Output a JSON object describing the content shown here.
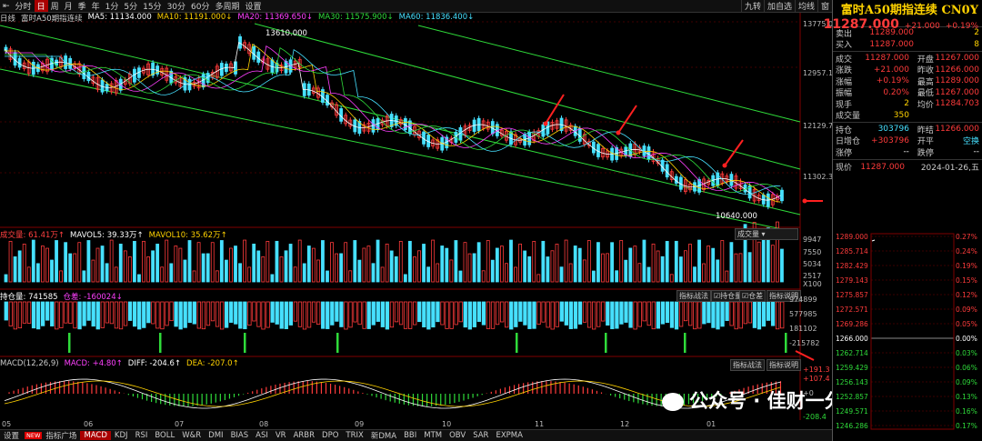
{
  "toolbar": {
    "items": [
      "分时",
      "日",
      "周",
      "月",
      "季",
      "年",
      "1分",
      "5分",
      "15分",
      "30分",
      "60分",
      "多周期",
      "设置"
    ],
    "active": "日",
    "right": [
      "九转",
      "加自选",
      "均线",
      "窗"
    ]
  },
  "ma_legend": {
    "name": "富时A50期指连续",
    "ma5": "MA5: 11134.000",
    "ma10": "MA10: 11191.000↓",
    "ma20": "MA20: 11369.650↓",
    "ma30": "MA30: 11575.900↓",
    "ma60": "MA60: 11836.400↓",
    "prefix": "日线"
  },
  "price_axis": [
    "13775.00",
    "12957.13",
    "12129.75",
    "11302.37"
  ],
  "annotations": {
    "high": "13610.000",
    "low": "10640.000"
  },
  "volume": {
    "label": "成交量: 61.41万↑",
    "mavol5": "MAVOL5: 39.33万↑",
    "mavol10": "MAVOL10: 35.62万↑",
    "selector": "成交量",
    "axis": [
      "9947",
      "7550",
      "5034",
      "2517",
      "X100"
    ]
  },
  "oi": {
    "label": "持仓量: 741585",
    "change": "仓差: -160024↓",
    "buttons": [
      "指标战法",
      "持仓量",
      "仓差",
      "指标说明"
    ],
    "axis": [
      "974899",
      "577985",
      "181102",
      "-215782"
    ]
  },
  "macd": {
    "label": "MACD(12,26,9)",
    "macd": "MACD: +4.80↑",
    "diff": "DIFF: -204.6↑",
    "dea": "DEA: -207.0↑",
    "buttons": [
      "指标战法",
      "指标说明"
    ],
    "axis": [
      "+191.3",
      "+107.4",
      "+0",
      "-208.4"
    ]
  },
  "months": [
    "05",
    "06",
    "07",
    "08",
    "09",
    "10",
    "11",
    "12",
    "01"
  ],
  "bottom_nav": [
    "设置",
    "指标广场",
    "MACD",
    "KDJ",
    "RSI",
    "BOLL",
    "W&R",
    "DMI",
    "BIAS",
    "ASI",
    "VR",
    "ARBR",
    "DPO",
    "TRIX",
    "新DMA",
    "BBI",
    "MTM",
    "OBV",
    "SAR",
    "EXPMA"
  ],
  "bottom_nav_active": "MACD",
  "bottom_nav_new": "NEW",
  "quote": {
    "name": "富时A50期指连续 CN0Y",
    "price": "11287.000",
    "change": "+21.000",
    "pct": "+0.19%",
    "ask_label": "卖出",
    "ask": "11289.000",
    "ask_vol": "2",
    "bid_label": "买入",
    "bid": "11287.000",
    "bid_vol": "8",
    "rows": [
      {
        "k": "成交",
        "v": "11287.000",
        "k2": "开盘",
        "v2": "11267.000"
      },
      {
        "k": "涨跌",
        "v": "+21.000",
        "k2": "昨收",
        "v2": "11266.000"
      },
      {
        "k": "涨幅",
        "v": "+0.19%",
        "k2": "最高",
        "v2": "11289.000"
      },
      {
        "k": "振幅",
        "v": "0.20%",
        "k2": "最低",
        "v2": "11267.000"
      },
      {
        "k": "现手",
        "v": "2",
        "k2": "均价",
        "v2": "11284.703"
      },
      {
        "k": "成交量",
        "v": "350",
        "k2": "",
        "v2": ""
      }
    ],
    "rows2": [
      {
        "k": "持仓",
        "v": "303796",
        "k2": "昨结",
        "v2": "11266.000"
      },
      {
        "k": "日增仓",
        "v": "+303796",
        "k2": "开平",
        "v2": "空换"
      },
      {
        "k": "涨停",
        "v": "",
        "k2": "跌停",
        "v2": ""
      }
    ],
    "dash": "--",
    "current_label": "现价",
    "current": "11287.000",
    "date": "2024-01-26,五"
  },
  "intraday": {
    "left": [
      "1289.000",
      "1285.714",
      "1282.429",
      "1279.143",
      "1275.857",
      "1272.571",
      "1269.286",
      "1266.000",
      "1262.714",
      "1259.429",
      "1256.143",
      "1252.857",
      "1249.571",
      "1246.286"
    ],
    "right": [
      "0.27%",
      "0.24%",
      "0.19%",
      "0.15%",
      "0.12%",
      "0.09%",
      "0.05%",
      "0.00%",
      "0.03%",
      "0.06%",
      "0.09%",
      "0.13%",
      "0.16%",
      "0.17%"
    ]
  },
  "watermark": "公众号 · 佳财一分钟"
}
